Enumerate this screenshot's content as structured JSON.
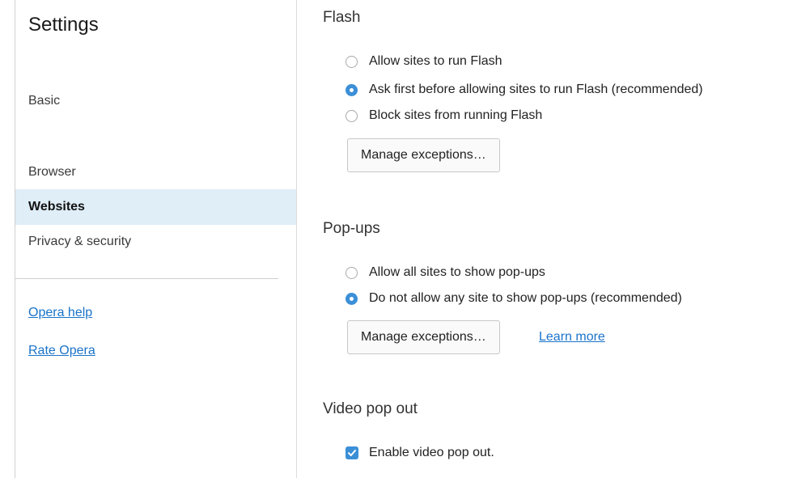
{
  "sidebar": {
    "title": "Settings",
    "items": [
      {
        "label": "Basic"
      },
      {
        "label": "Browser"
      },
      {
        "label": "Websites"
      },
      {
        "label": "Privacy & security"
      }
    ],
    "links": [
      {
        "label": "Opera help"
      },
      {
        "label": "Rate Opera"
      }
    ]
  },
  "flash": {
    "title": "Flash",
    "options": [
      {
        "label": "Allow sites to run Flash",
        "selected": false
      },
      {
        "label": "Ask first before allowing sites to run Flash (recommended)",
        "selected": true
      },
      {
        "label": "Block sites from running Flash",
        "selected": false
      }
    ],
    "manage_button": "Manage exceptions…"
  },
  "popups": {
    "title": "Pop-ups",
    "options": [
      {
        "label": "Allow all sites to show pop-ups",
        "selected": false
      },
      {
        "label": "Do not allow any site to show pop-ups (recommended)",
        "selected": true
      }
    ],
    "manage_button": "Manage exceptions…",
    "learn_more": "Learn more"
  },
  "video_popout": {
    "title": "Video pop out",
    "checkbox_label": "Enable video pop out.",
    "checked": true
  },
  "colors": {
    "accent": "#3b8fd6",
    "link": "#1a73c9",
    "active_bg": "#dfeef7"
  }
}
